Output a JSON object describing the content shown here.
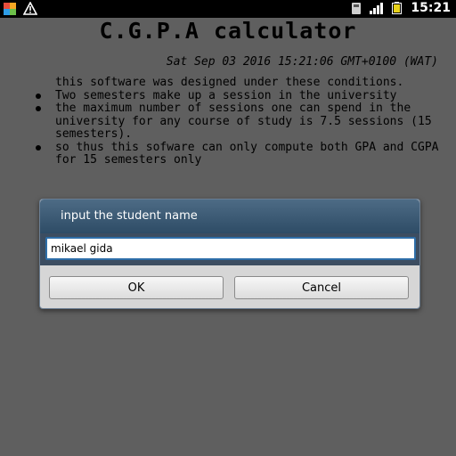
{
  "status_bar": {
    "time": "15:21",
    "icons": [
      "app-grid-icon",
      "warning-icon",
      "sd-card-icon",
      "signal-icon",
      "battery-icon"
    ]
  },
  "app": {
    "title": "C.G.P.A calculator",
    "date": "Sat Sep 03 2016 15:21:06 GMT+0100 (WAT)",
    "intro": "this software was designed under these conditions.",
    "bullets": [
      "Two semesters make up a session in the university",
      "the maximum number of sessions one can spend in the university for any course of study is 7.5 sessions (15 semesters).",
      "so thus this sofware can only compute both GPA and CGPA for 15 semesters only"
    ]
  },
  "dialog": {
    "title": "input the student name",
    "input_value": "mikael gida",
    "ok_label": "OK",
    "cancel_label": "Cancel"
  },
  "colors": {
    "background": "#5f5f5f",
    "status_bar": "#000000",
    "dialog_header": "#3d5a75",
    "input_border": "#2e6ea8",
    "battery": "#e8d21a"
  }
}
